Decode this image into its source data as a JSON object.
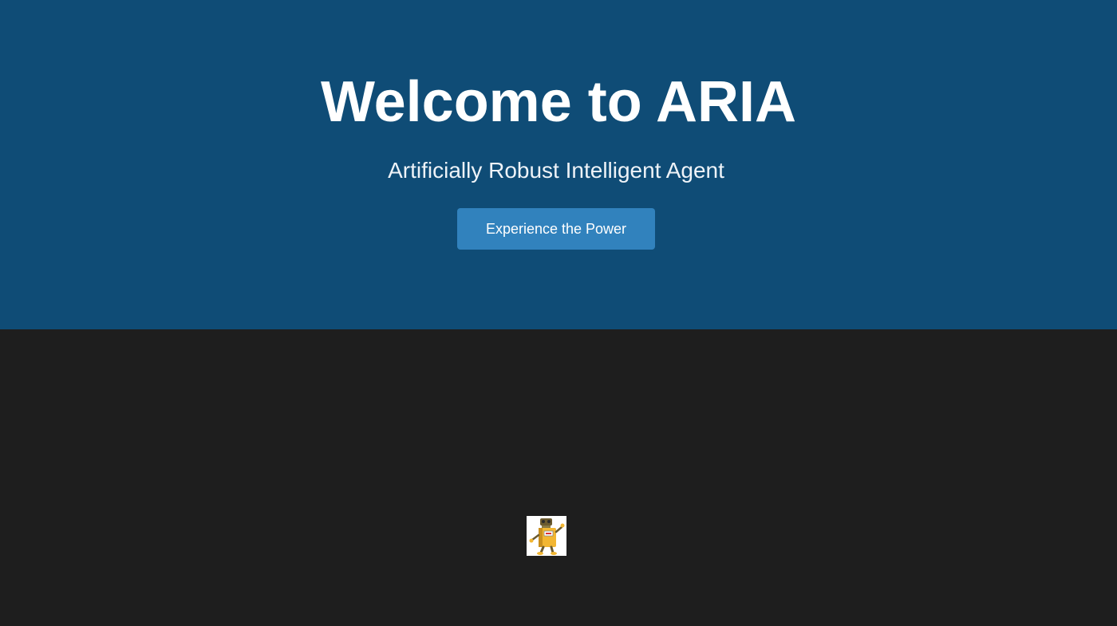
{
  "hero": {
    "title": "Welcome to ARIA",
    "subtitle": "Artificially Robust Intelligent Agent",
    "cta_label": "Experience the Power",
    "background_color": "#0f4c76",
    "button_color": "#3182bd"
  },
  "lower_section": {
    "background_color": "#1e1e1e",
    "image": {
      "icon": "robot-icon"
    }
  }
}
